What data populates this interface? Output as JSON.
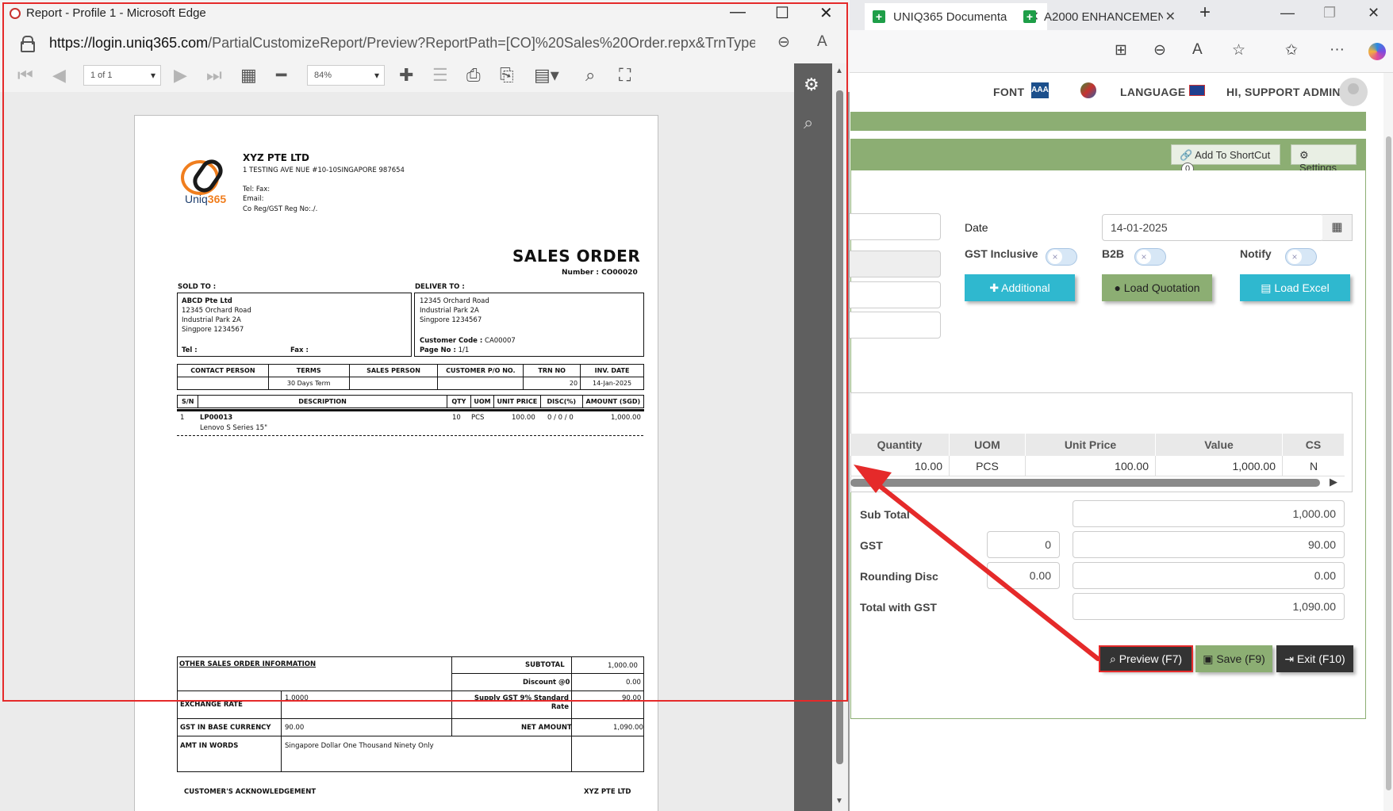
{
  "background_browser": {
    "tabs": [
      {
        "label": "UNIQ365 Documenta",
        "icon": "sheets-icon"
      },
      {
        "label": "A2000 ENHANCEMEN",
        "icon": "sheets-icon"
      }
    ],
    "new_tab": "+",
    "window_controls": {
      "minimize": "—",
      "restore": "❐",
      "close": "✕"
    }
  },
  "app_header": {
    "font_label": "FONT",
    "font_badge": "AAA",
    "language_label": "LANGUAGE",
    "user_greeting": "HI, SUPPORT ADMIN"
  },
  "shortcut_bar": {
    "add_shortcut": "Add To ShortCut",
    "shortcut_count": "0",
    "settings": "Settings"
  },
  "form": {
    "date_label": "Date",
    "date_value": "14-01-2025",
    "gst_inclusive_label": "GST Inclusive",
    "b2b_label": "B2B",
    "notify_label": "Notify",
    "btn_additional": "Additional",
    "btn_load_quotation": "Load Quotation",
    "btn_load_excel": "Load Excel"
  },
  "grid": {
    "columns": [
      "Quantity",
      "UOM",
      "Unit Price",
      "Value",
      "CS"
    ],
    "rows": [
      [
        "10.00",
        "PCS",
        "100.00",
        "1,000.00",
        "N"
      ]
    ]
  },
  "totals": {
    "sub_total_label": "Sub Total",
    "sub_total": "1,000.00",
    "gst_label": "GST",
    "gst_rate": "0",
    "gst_amount": "90.00",
    "rounding_label": "Rounding Disc",
    "rounding_left": "0.00",
    "rounding_right": "0.00",
    "total_label": "Total with GST",
    "total": "1,090.00"
  },
  "bottom_buttons": {
    "preview": "Preview (F7)",
    "save": "Save (F9)",
    "exit": "Exit (F10)"
  },
  "popup": {
    "title": "Report - Profile 1 - Microsoft Edge",
    "url_host": "https://login.uniq365.com",
    "url_path": "/PartialCustomizeReport/Preview?ReportPath=[CO]%20Sales%20Order.repx&TrnType=C...",
    "page_indicator": "1 of 1",
    "zoom": "84%"
  },
  "report": {
    "company_name": "XYZ PTE LTD",
    "company_address": "1 TESTING AVE NUE #10-10SINGAPORE 987654",
    "tel_fax": "Tel: Fax:",
    "email": "Email:",
    "reg_no": "Co Reg/GST Reg No:./.",
    "logo_text_a": "Uniq",
    "logo_text_b": "365",
    "doc_title": "SALES ORDER",
    "number_label": "Number : CO00020",
    "sold_to_label": "SOLD TO :",
    "deliver_to_label": "DELIVER TO :",
    "sold_to": [
      "ABCD Pte Ltd",
      "12345 Orchard Road",
      "Industrial Park 2A",
      "Singpore 1234567"
    ],
    "sold_tel": "Tel :",
    "sold_fax": "Fax :",
    "deliver_to": [
      "12345 Orchard Road",
      "Industrial Park 2A",
      "Singpore 1234567"
    ],
    "customer_code_label": "Customer Code :",
    "customer_code": "CA00007",
    "page_no_label": "Page No :",
    "page_no": "1/1",
    "info_headers": [
      "CONTACT PERSON",
      "TERMS",
      "SALES PERSON",
      "CUSTOMER P/O NO.",
      "TRN NO",
      "INV. DATE"
    ],
    "info_values": [
      "",
      "30 Days Term",
      "",
      "",
      "20",
      "14-Jan-2025"
    ],
    "line_headers": [
      "S/N",
      "DESCRIPTION",
      "QTY",
      "UOM",
      "UNIT PRICE",
      "DISC(%)",
      "AMOUNT (SGD)"
    ],
    "line_sn": "1",
    "line_code": "LP00013",
    "line_desc": "Lenovo S Series 15\"",
    "line_qty": "10",
    "line_uom": "PCS",
    "line_price": "100.00",
    "line_disc": "0 / 0 / 0",
    "line_amount": "1,000.00",
    "other_info_label": "OTHER SALES ORDER INFORMATION",
    "subtotal_label": "SUBTOTAL",
    "subtotal": "1,000.00",
    "discount_label": "Discount @0",
    "discount": "0.00",
    "exchange_label": "EXCHANGE RATE",
    "exchange_rate": "1.0000",
    "supply_gst_label_1": "Supply GST 9% Standard",
    "supply_gst_label_2": "Rate",
    "supply_gst": "90.00",
    "gst_base_label": "GST IN BASE CURRENCY",
    "gst_base": "90.00",
    "net_amount_label": "NET AMOUNT",
    "net_amount": "1,090.00",
    "amt_words_label": "AMT IN WORDS",
    "amt_words": "Singapore Dollar One Thousand Ninety Only",
    "ack_label": "CUSTOMER'S ACKNOWLEDGEMENT",
    "ack_company": "XYZ PTE LTD"
  },
  "colors": {
    "accent_green": "#8cae73",
    "additional_btn": "#2fb8cf",
    "preview_btn": "#333333",
    "annotation_red": "#e52a2a",
    "logo_orange": "#f07e1e"
  }
}
